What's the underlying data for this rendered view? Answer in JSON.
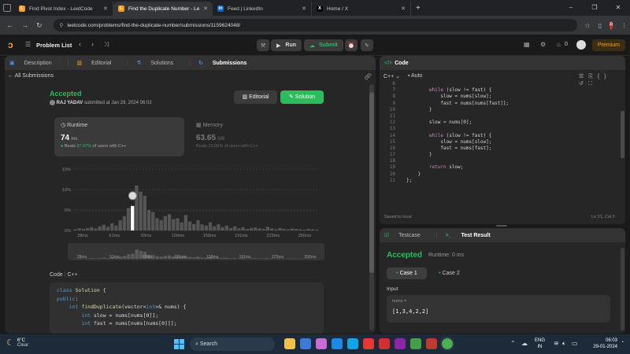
{
  "browser": {
    "tabs": [
      {
        "title": "Find Pivot Index - LeetCode",
        "fav": "L",
        "color": "#f89f1b"
      },
      {
        "title": "Find the Duplicate Number - Le",
        "fav": "L",
        "color": "#f89f1b",
        "active": true
      },
      {
        "title": "Feed | LinkedIn",
        "fav": "in",
        "color": "#0a66c2"
      },
      {
        "title": "Home / X",
        "fav": "X",
        "color": "#ffffff"
      }
    ],
    "new_tab": "+",
    "url": "leetcode.com/problems/find-the-duplicate-number/submissions/1159624048/"
  },
  "header": {
    "problem_list": "Problem List",
    "run": "Run",
    "submit": "Submit",
    "premium": "Premium",
    "streak": "0"
  },
  "left": {
    "tabs": [
      "Description",
      "Editorial",
      "Solutions",
      "Submissions"
    ],
    "all_submissions": "All Submissions",
    "status": "Accepted",
    "user": "RAJ YADAV",
    "submitted": "submitted at Jan 29, 2024 06:02",
    "editorial_btn": "Editorial",
    "solution_btn": "Solution",
    "runtime": {
      "label": "Runtime",
      "value": "74",
      "unit": "ms",
      "beats_pre": "Beats",
      "beats_pct": "87.97%",
      "beats_post": "of users with C++"
    },
    "memory": {
      "label": "Memory",
      "value": "63.65",
      "unit": "MB",
      "beats": "Beats 29.06% of users with C++"
    },
    "code_label": "Code",
    "code_lang": "C++",
    "snippet": [
      "class Solution {",
      "public:",
      "    int findDuplicate(vector<int>& nums) {",
      "        int slow = nums[nums[0]];",
      "        int fast = nums[nums[nums[0]]];"
    ]
  },
  "chart_data": {
    "type": "bar",
    "y_ticks": [
      "15%",
      "10%",
      "5%",
      "0%"
    ],
    "x_ticks": [
      "28ms",
      "61ms",
      "93ms",
      "126ms",
      "158ms",
      "191ms",
      "223ms",
      "256ms"
    ],
    "ylim": [
      0,
      15
    ],
    "values": [
      0.3,
      0.5,
      0.4,
      0.6,
      0.8,
      0.5,
      1.0,
      1.4,
      0.9,
      1.8,
      1.2,
      2.5,
      3.5,
      5.5,
      6.0,
      11.0,
      9.5,
      8.5,
      5.0,
      4.5,
      3.0,
      2.5,
      3.5,
      4.0,
      2.8,
      3.0,
      2.0,
      3.8,
      2.2,
      1.6,
      2.5,
      1.5,
      1.2,
      2.0,
      1.0,
      1.5,
      0.8,
      1.2,
      0.6,
      1.0,
      0.5,
      0.8,
      0.4,
      0.6,
      0.7,
      0.5,
      0.4,
      0.9,
      0.5,
      0.3,
      0.6,
      0.4,
      0.3,
      0.5,
      0.4,
      0.3,
      0.2,
      0.4,
      0.3,
      0.2
    ],
    "highlight_index": 14
  },
  "code": {
    "title": "Code",
    "lang": "C++",
    "auto": "Auto",
    "lines": [
      {
        "n": "6",
        "t": ""
      },
      {
        "n": "7",
        "t": "        while (slow != fast) {"
      },
      {
        "n": "8",
        "t": "            slow = nums[slow];"
      },
      {
        "n": "9",
        "t": "            fast = nums[nums[fast]];"
      },
      {
        "n": "10",
        "t": "        }"
      },
      {
        "n": "11",
        "t": ""
      },
      {
        "n": "12",
        "t": "        slow = nums[0];"
      },
      {
        "n": "13",
        "t": ""
      },
      {
        "n": "14",
        "t": "        while (slow != fast) {"
      },
      {
        "n": "15",
        "t": "            slow = nums[slow];"
      },
      {
        "n": "16",
        "t": "            fast = nums[fast];"
      },
      {
        "n": "17",
        "t": "        }"
      },
      {
        "n": "18",
        "t": ""
      },
      {
        "n": "19",
        "t": "        return slow;"
      },
      {
        "n": "20",
        "t": "    }"
      },
      {
        "n": "21",
        "t": "};"
      }
    ],
    "saved": "Saved to local",
    "cursor": "Ln 21, Col 3"
  },
  "test": {
    "tabs": [
      "Testcase",
      "Test Result"
    ],
    "status": "Accepted",
    "runtime": "Runtime: 0 ms",
    "case1": "Case 1",
    "case2": "Case 2",
    "input_label": "Input",
    "var": "nums =",
    "value": "[1,3,4,2,2]"
  },
  "taskbar": {
    "temp": "6°C",
    "weather": "Clear",
    "search": "Search",
    "lang1": "ENG",
    "lang2": "IN",
    "time": "06:03",
    "date": "29-01-2024"
  }
}
